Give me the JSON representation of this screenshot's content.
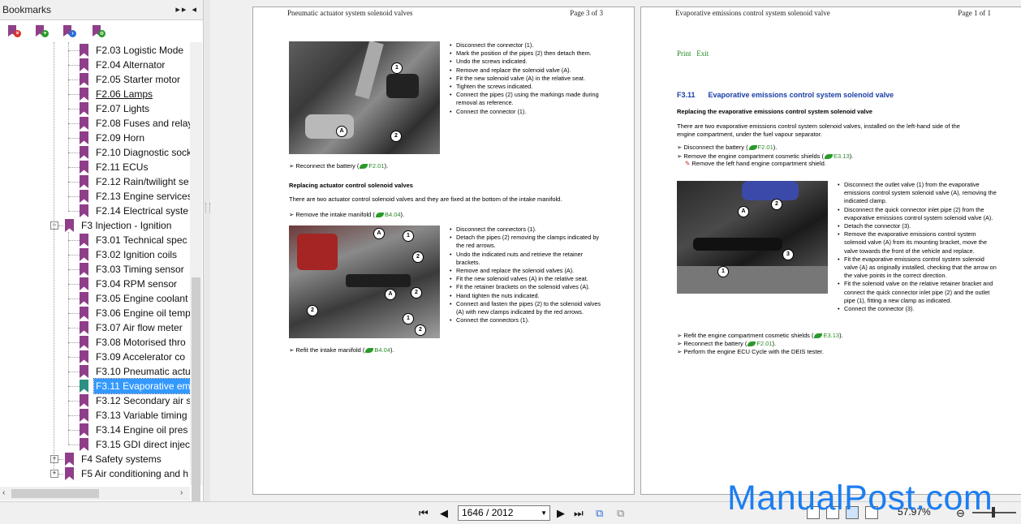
{
  "sidebar": {
    "title": "Bookmarks",
    "controls": "▸▸ ◂",
    "tree": [
      {
        "label": "F2.03 Logistic Mode",
        "level": 2
      },
      {
        "label": "F2.04 Alternator",
        "level": 2
      },
      {
        "label": "F2.05 Starter motor",
        "level": 2
      },
      {
        "label": "F2.06 Lamps",
        "level": 2,
        "underline": true
      },
      {
        "label": "F2.07 Lights",
        "level": 2
      },
      {
        "label": "F2.08 Fuses and relay",
        "level": 2
      },
      {
        "label": "F2.09 Horn",
        "level": 2
      },
      {
        "label": "F2.10 Diagnostic sock",
        "level": 2
      },
      {
        "label": "F2.11 ECUs",
        "level": 2
      },
      {
        "label": "F2.12 Rain/twilight se",
        "level": 2
      },
      {
        "label": "F2.13 Engine services",
        "level": 2
      },
      {
        "label": "F2.14 Electrical syste",
        "level": 2
      },
      {
        "label": "F3 Injection - Ignition",
        "level": 1,
        "expanded": true
      },
      {
        "label": "F3.01 Technical spec",
        "level": 2
      },
      {
        "label": "F3.02 Ignition coils",
        "level": 2
      },
      {
        "label": "F3.03 Timing sensor",
        "level": 2
      },
      {
        "label": "F3.04 RPM sensor",
        "level": 2
      },
      {
        "label": "F3.05 Engine coolant",
        "level": 2
      },
      {
        "label": "F3.06 Engine oil temp",
        "level": 2
      },
      {
        "label": "F3.07 Air flow meter",
        "level": 2
      },
      {
        "label": "F3.08 Motorised thro",
        "level": 2
      },
      {
        "label": "F3.09 Accelerator co",
        "level": 2
      },
      {
        "label": "F3.10 Pneumatic actu",
        "level": 2
      },
      {
        "label": "F3.11 Evaporative em",
        "level": 2,
        "selected": true
      },
      {
        "label": "F3.12 Secondary air s",
        "level": 2
      },
      {
        "label": "F3.13 Variable timing",
        "level": 2
      },
      {
        "label": "F3.14 Engine oil pres",
        "level": 2
      },
      {
        "label": "F3.15 GDI direct injec",
        "level": 2
      },
      {
        "label": "F4 Safety systems",
        "level": 1,
        "collapsed": true
      },
      {
        "label": "F5 Air conditioning and h",
        "level": 1,
        "collapsed": true
      }
    ]
  },
  "page1": {
    "header_left": "Pneumatic actuator system solenoid valves",
    "header_right": "Page 3 of 3",
    "steps_a": [
      "Disconnect the connector (1).",
      "Mark the position of the pipes (2) then detach them.",
      "Undo the screws indicated.",
      "Remove and replace the solenoid valve (A).",
      "Fit the new solenoid valve (A) in the relative seat.",
      "Tighten the screws indicated.",
      "Connect the pipes (2) using the markings made during removal as reference.",
      "Connect the connector (1)."
    ],
    "reconnect_text": "Reconnect the battery (",
    "reconnect_ref": "F2.01",
    "reconnect_end": ").",
    "sub_title": "Replacing actuator control solenoid valves",
    "sub_intro": "There are two actuator control solenoid valves and they are fixed at the bottom of the intake manifold.",
    "remove_text": "Remove the intake manifold (",
    "remove_ref": "B4.04",
    "remove_end": ").",
    "steps_b": [
      "Disconnect the connectors (1).",
      "Detach the pipes (2) removing the clamps indicated by the red arrows.",
      "Undo the indicated nuts and retrieve the retainer brackets.",
      "Remove and replace the solenoid valves (A).",
      "Fit the new solenoid valves (A) in the relative seat.",
      "Fit the retainer brackets on the solenoid valves (A).",
      "Hand tighten the nuts indicated.",
      "Connect and fasten the pipes (2) to the solenoid valves (A) with new clamps indicated by the red arrows.",
      "Connect the connectors (1)."
    ],
    "refit_text": "Refit the intake manifold (",
    "refit_ref": "B4.04",
    "refit_end": ")."
  },
  "page2": {
    "header_left": "Evaporative emissions control system solenoid valve",
    "header_right": "Page 1 of 1",
    "print": "Print",
    "exit": "Exit",
    "sec_num": "F3.11",
    "sec_title": "Evaporative emissions control system solenoid valve",
    "sub_title": "Replacing the evaporative emissions control system solenoid valve",
    "intro": "There are two evaporative emissions control system solenoid valves, installed on the left-hand side of the engine compartment, under the fuel vapour separator.",
    "disc_text": "Disconnect the battery (",
    "disc_ref": "F2.01",
    "disc_end": ").",
    "rem_text": "Remove the engine compartment cosmetic shields (",
    "rem_ref": "E3.13",
    "rem_end": ").",
    "rem_sub": "Remove the left hand engine compartment shield.",
    "steps": [
      "Disconnect the outlet valve (1) from the evaporative emissions control system solenoid valve (A), removing the indicated clamp.",
      "Disconnect the quick connector inlet pipe (2) from the evaporative emissions control system solenoid valve (A).",
      "Detach the connector (3).",
      "Remove the evaporative emissions control system solenoid valve (A) from its mounting bracket, move the valve towards the front of the vehicle and replace.",
      "Fit the evaporative emissions control system solenoid valve (A) as originally installed, checking that the arrow on the valve points in the correct direction.",
      "Fit the solenoid valve on the relative retainer bracket and connect the quick connector inlet pipe (2) and the outlet pipe (1), fitting a new clamp as indicated.",
      "Connect the connector (3)."
    ],
    "refit_text": "Refit the engine compartment cosmetic shields (",
    "refit_ref": "E3.13",
    "refit_end": ").",
    "recon_text": "Reconnect the battery (",
    "recon_ref": "F2.01",
    "recon_end": ").",
    "ecu_text": "Perform the engine ECU Cycle with the DEIS tester."
  },
  "callouts": {
    "one": "1",
    "two": "2",
    "three": "3",
    "a": "A"
  },
  "toolbar": {
    "page_value": "1646 / 2012",
    "zoom": "57.97%"
  },
  "watermark": "ManualPost.com",
  "colors": {
    "accent": "#3399ff",
    "bookmark": "#8f3f8a",
    "link_green": "#2a8a2a",
    "title_blue": "#1a3ea8",
    "watermark": "#1d7ef0"
  }
}
